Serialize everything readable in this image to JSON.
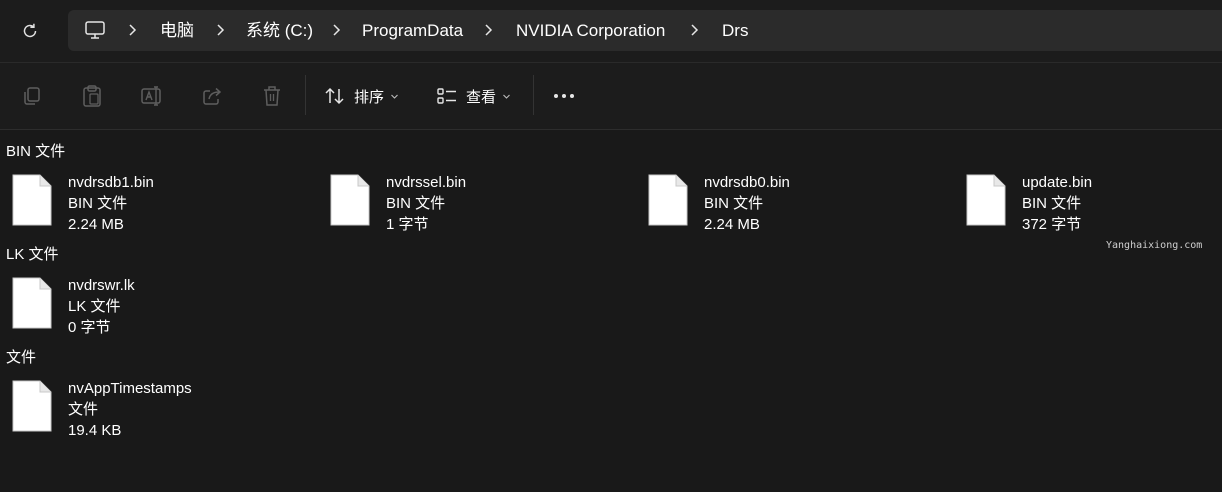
{
  "address_bar": {
    "breadcrumbs": [
      "电脑",
      "系统 (C:)",
      "ProgramData",
      "NVIDIA Corporation",
      "Drs"
    ]
  },
  "toolbar": {
    "sort_label": "排序",
    "view_label": "查看",
    "more_label": "..."
  },
  "groups": [
    {
      "title": "BIN 文件",
      "files": [
        {
          "name": "nvdrsdb1.bin",
          "type": "BIN 文件",
          "size": "2.24 MB"
        },
        {
          "name": "nvdrssel.bin",
          "type": "BIN 文件",
          "size": "1 字节"
        },
        {
          "name": "nvdrsdb0.bin",
          "type": "BIN 文件",
          "size": "2.24 MB"
        },
        {
          "name": "update.bin",
          "type": "BIN 文件",
          "size": "372 字节"
        }
      ]
    },
    {
      "title": "LK 文件",
      "files": [
        {
          "name": "nvdrswr.lk",
          "type": "LK 文件",
          "size": "0 字节"
        }
      ]
    },
    {
      "title": "文件",
      "files": [
        {
          "name": "nvAppTimestamps",
          "type": "文件",
          "size": "19.4 KB"
        }
      ]
    }
  ],
  "watermark": "Yanghaixiong.com"
}
